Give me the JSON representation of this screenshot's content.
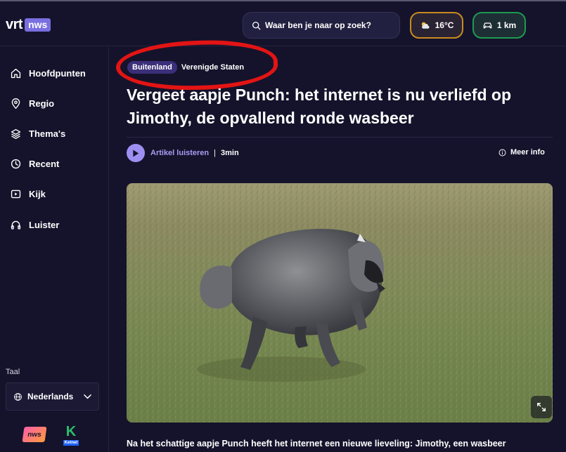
{
  "brand": {
    "logo_main": "vrt",
    "logo_badge": "nws"
  },
  "header": {
    "search_placeholder": "Waar ben je naar op zoek?",
    "weather": {
      "value": "16°C",
      "icon": "partly-cloudy-icon",
      "accent": "#c98b1f"
    },
    "traffic": {
      "value": "1 km",
      "icon": "car-icon",
      "accent": "#1d9b4f"
    }
  },
  "sidebar": {
    "items": [
      {
        "label": "Hoofdpunten",
        "icon": "home-icon"
      },
      {
        "label": "Regio",
        "icon": "location-pin-icon"
      },
      {
        "label": "Thema's",
        "icon": "layers-icon"
      },
      {
        "label": "Recent",
        "icon": "clock-icon"
      },
      {
        "label": "Kijk",
        "icon": "play-box-icon"
      },
      {
        "label": "Luister",
        "icon": "headphones-icon"
      }
    ],
    "language_heading": "Taal",
    "language_selected": "Nederlands",
    "apps": {
      "nws": "nws",
      "ketnet_caption": "Ketnet"
    }
  },
  "article": {
    "tag_primary": "Buitenland",
    "tag_secondary": "Verenigde Staten",
    "title": "Vergeet aapje Punch: het internet is nu verliefd op Jimothy, de opvallend ronde wasbeer",
    "listen_label": "Artikel luisteren",
    "separator": "|",
    "duration": "3min",
    "more_info": "Meer info",
    "intro": "Na het schattige aapje Punch heeft het internet een nieuwe lieveling: Jimothy, een wasbeer"
  },
  "colors": {
    "background": "#15132b",
    "accent_purple": "#9d8ff2",
    "tag_bg": "#3b2f7a",
    "annotation_red": "#e31414"
  }
}
